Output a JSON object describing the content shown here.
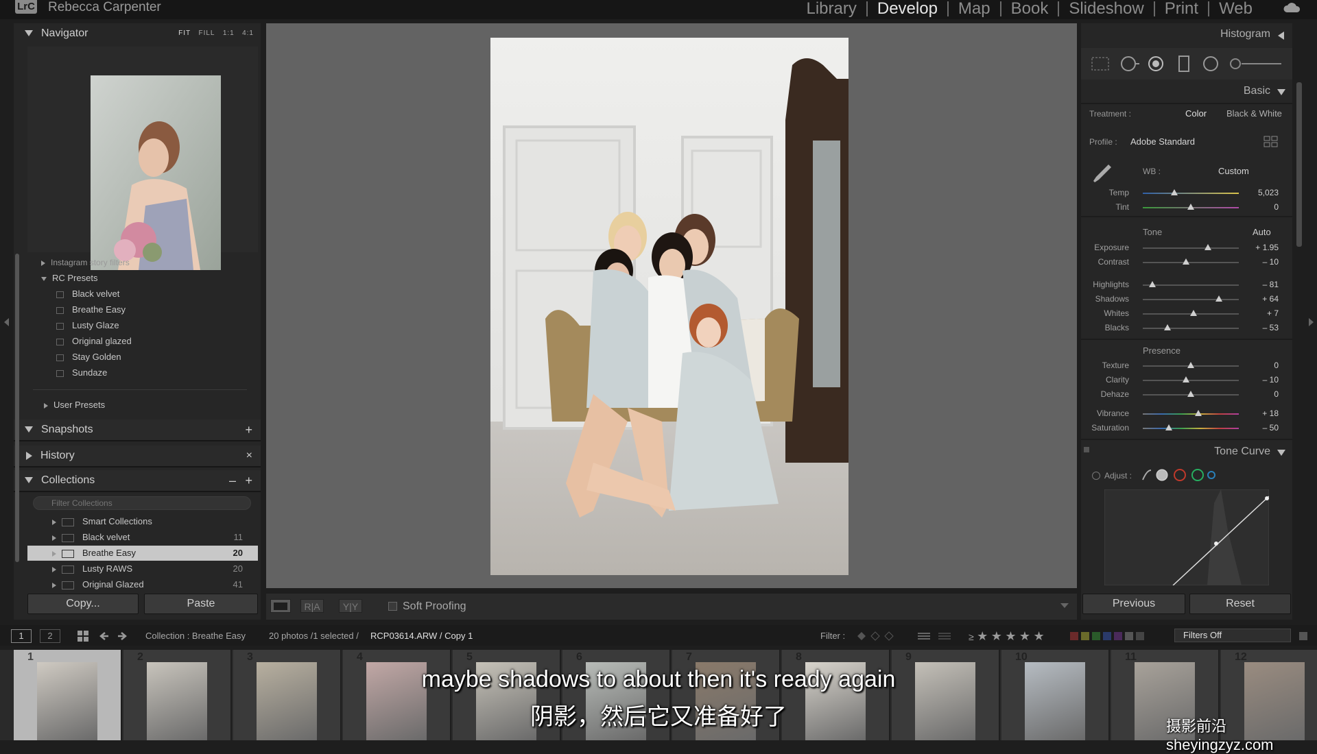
{
  "app": {
    "logo": "LrC",
    "identity": "Rebecca Carpenter"
  },
  "modules": [
    "Library",
    "Develop",
    "Map",
    "Book",
    "Slideshow",
    "Print",
    "Web"
  ],
  "active_module": "Develop",
  "navigator": {
    "title": "Navigator",
    "zoom_options": [
      "FIT",
      "FILL",
      "1:1",
      "4:1"
    ]
  },
  "presets": {
    "instagram_group": "Instagram story filters",
    "rc_group": "RC Presets",
    "rc_items": [
      "Black velvet",
      "Breathe Easy",
      "Lusty Glaze",
      "Original glazed",
      "Stay Golden",
      "Sundaze"
    ],
    "user_group": "User Presets"
  },
  "snapshots": {
    "title": "Snapshots",
    "action": "+"
  },
  "history": {
    "title": "History",
    "action": "×"
  },
  "collections": {
    "title": "Collections",
    "actions": [
      "–",
      "+"
    ],
    "filter_placeholder": "Filter Collections",
    "items": [
      {
        "name": "Smart Collections",
        "count": ""
      },
      {
        "name": "Black velvet",
        "count": "11"
      },
      {
        "name": "Breathe Easy",
        "count": "20"
      },
      {
        "name": "Lusty RAWS",
        "count": "20"
      },
      {
        "name": "Original Glazed",
        "count": "41"
      }
    ]
  },
  "left_buttons": {
    "copy": "Copy...",
    "paste": "Paste"
  },
  "center_toolbar": {
    "soft_proofing": "Soft Proofing",
    "ra": "R|A",
    "yy": "Y|Y"
  },
  "right_panel": {
    "histogram_title": "Histogram",
    "basic_title": "Basic",
    "treatment_label": "Treatment :",
    "treatment_color": "Color",
    "treatment_bw": "Black & White",
    "profile_label": "Profile :",
    "profile_value": "Adobe Standard",
    "wb_label": "WB :",
    "wb_value": "Custom",
    "tone_label": "Tone",
    "tone_auto": "Auto",
    "presence_label": "Presence",
    "sliders_wb": [
      {
        "label": "Temp",
        "value": "5,023",
        "pos": 0.33
      },
      {
        "label": "Tint",
        "value": "0",
        "pos": 0.5
      }
    ],
    "sliders_tone": [
      {
        "label": "Exposure",
        "value": "+ 1.95",
        "pos": 0.68
      },
      {
        "label": "Contrast",
        "value": "– 10",
        "pos": 0.45
      }
    ],
    "sliders_tone2": [
      {
        "label": "Highlights",
        "value": "– 81",
        "pos": 0.1
      },
      {
        "label": "Shadows",
        "value": "+ 64",
        "pos": 0.79
      },
      {
        "label": "Whites",
        "value": "+ 7",
        "pos": 0.53
      },
      {
        "label": "Blacks",
        "value": "– 53",
        "pos": 0.26
      }
    ],
    "sliders_presence": [
      {
        "label": "Texture",
        "value": "0",
        "pos": 0.5
      },
      {
        "label": "Clarity",
        "value": "– 10",
        "pos": 0.45
      },
      {
        "label": "Dehaze",
        "value": "0",
        "pos": 0.5
      }
    ],
    "sliders_color": [
      {
        "label": "Vibrance",
        "value": "+ 18",
        "pos": 0.58
      },
      {
        "label": "Saturation",
        "value": "– 50",
        "pos": 0.27
      }
    ],
    "tone_curve_title": "Tone Curve",
    "adjust_label": "Adjust :",
    "previous": "Previous",
    "reset": "Reset"
  },
  "filmbar": {
    "view_buttons": [
      "1",
      "2"
    ],
    "collection_text": "Collection : Breathe Easy",
    "photos_text": "20 photos /1 selected /",
    "file_text": "RCP03614.ARW / Copy 1",
    "filter_label": "Filter :",
    "filters_off": "Filters Off",
    "star_symbol": "★",
    "rating_op": "≥"
  },
  "filmstrip": {
    "numbers": [
      "1",
      "2",
      "3",
      "4",
      "5",
      "6",
      "7",
      "8",
      "9",
      "10",
      "11",
      "12"
    ]
  },
  "subtitles": {
    "english": "maybe shadows to about then it's ready again",
    "chinese": "阴影，然后它又准备好了"
  },
  "watermark": "摄影前沿sheyingzyz.com"
}
